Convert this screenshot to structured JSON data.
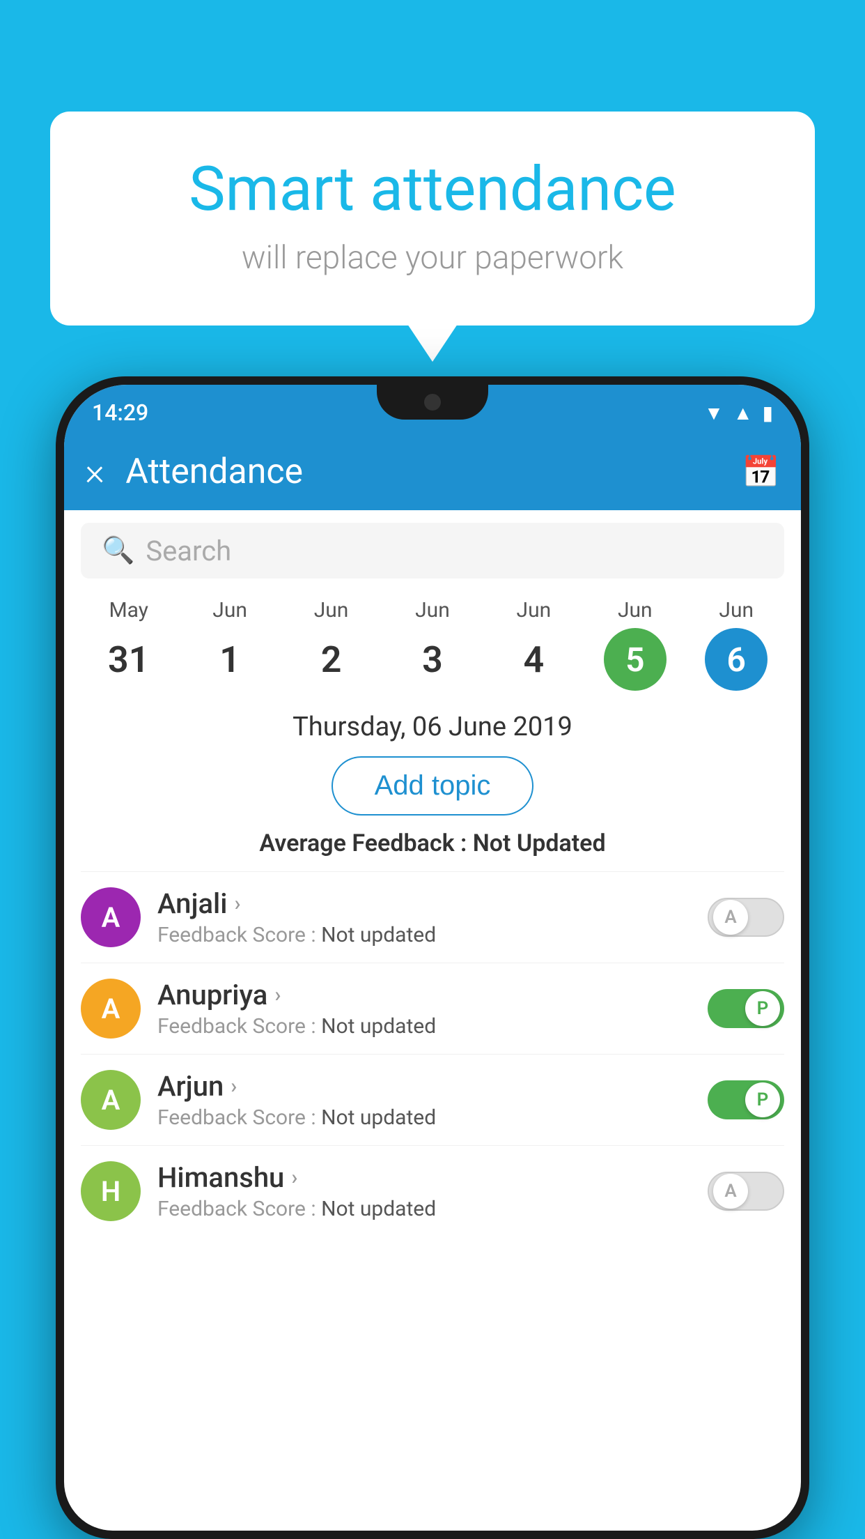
{
  "background": {
    "color": "#1ab8e8"
  },
  "speech_bubble": {
    "title": "Smart attendance",
    "subtitle": "will replace your paperwork"
  },
  "status_bar": {
    "time": "14:29"
  },
  "toolbar": {
    "title": "Attendance",
    "close_label": "×"
  },
  "search": {
    "placeholder": "Search"
  },
  "calendar": {
    "dates": [
      {
        "month": "May",
        "day": "31",
        "state": "normal"
      },
      {
        "month": "Jun",
        "day": "1",
        "state": "normal"
      },
      {
        "month": "Jun",
        "day": "2",
        "state": "normal"
      },
      {
        "month": "Jun",
        "day": "3",
        "state": "normal"
      },
      {
        "month": "Jun",
        "day": "4",
        "state": "normal"
      },
      {
        "month": "Jun",
        "day": "5",
        "state": "today"
      },
      {
        "month": "Jun",
        "day": "6",
        "state": "selected"
      }
    ]
  },
  "selected_date": {
    "full": "Thursday, 06 June 2019"
  },
  "add_topic": {
    "label": "Add topic"
  },
  "average_feedback": {
    "label": "Average Feedback : ",
    "value": "Not Updated"
  },
  "students": [
    {
      "name": "Anjali",
      "avatar_letter": "A",
      "avatar_color": "#9c27b0",
      "feedback": "Not updated",
      "toggle": "off",
      "toggle_label": "A"
    },
    {
      "name": "Anupriya",
      "avatar_letter": "A",
      "avatar_color": "#f5a623",
      "feedback": "Not updated",
      "toggle": "on",
      "toggle_label": "P"
    },
    {
      "name": "Arjun",
      "avatar_letter": "A",
      "avatar_color": "#8bc34a",
      "feedback": "Not updated",
      "toggle": "on",
      "toggle_label": "P"
    },
    {
      "name": "Himanshu",
      "avatar_letter": "H",
      "avatar_color": "#8bc34a",
      "feedback": "Not updated",
      "toggle": "off",
      "toggle_label": "A"
    }
  ]
}
